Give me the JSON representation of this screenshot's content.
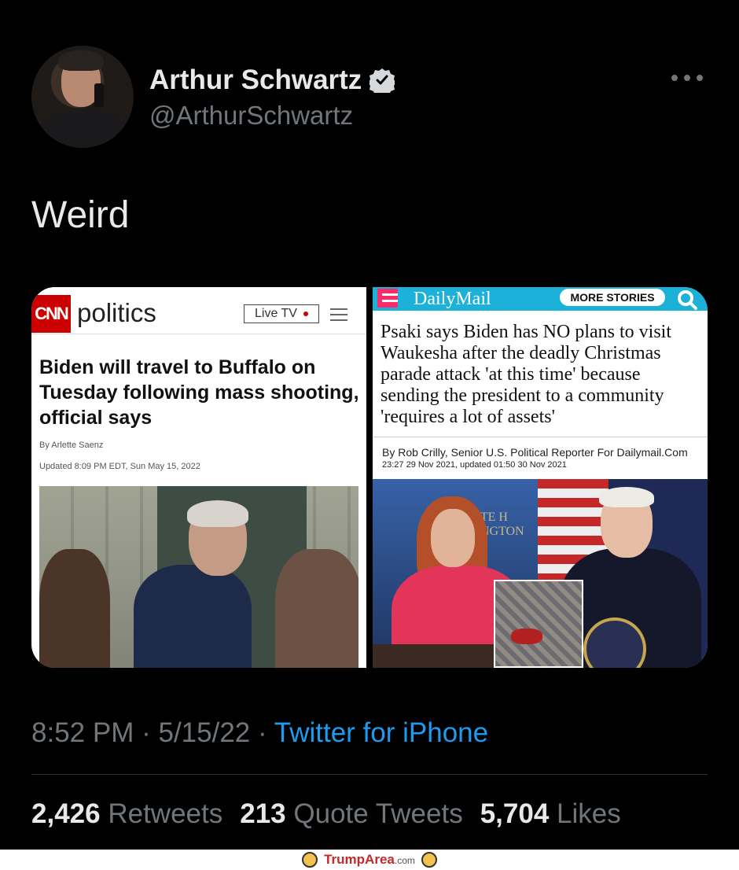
{
  "user": {
    "name": "Arthur Schwartz",
    "handle": "@ArthurSchwartz",
    "verified": true
  },
  "tweet": {
    "text": "Weird",
    "time": "8:52 PM",
    "date": "5/15/22",
    "source": "Twitter for iPhone",
    "separator": "·"
  },
  "media": {
    "left": {
      "brand_logo": "CNN",
      "section": "politics",
      "live_tv": "Live TV",
      "headline": "Biden will travel to Buffalo on Tuesday following mass shooting, official says",
      "byline": "By Arlette Saenz",
      "updated": "Updated 8:09 PM EDT, Sun May 15, 2022"
    },
    "right": {
      "brand_logo": "DailyMail",
      "more_stories": "MORE STORIES",
      "headline": "Psaki says Biden has NO plans to visit Waukesha after the deadly Christmas parade attack 'at this time' because sending the president to a community 'requires a lot of assets'",
      "byline": "By Rob Crilly, Senior U.S. Political Reporter For Dailymail.Com",
      "date": "23:27 29 Nov 2021, updated 01:50 30 Nov 2021",
      "photo_text": "HITE H\nHINGTON"
    }
  },
  "stats": {
    "retweets": {
      "count": "2,426",
      "label": "Retweets"
    },
    "quotes": {
      "count": "213",
      "label": "Quote Tweets"
    },
    "likes": {
      "count": "5,704",
      "label": "Likes"
    }
  },
  "watermark": {
    "name": "TrumpArea",
    "tld": ".com"
  },
  "colors": {
    "background": "#000000",
    "text_primary": "#e7e9ea",
    "text_secondary": "#71767b",
    "link": "#1d9bf0",
    "cnn_red": "#cc0000",
    "dailymail_blue": "#1bb1d8"
  },
  "icons": {
    "verified": "verified-badge-icon",
    "more": "more-options-icon",
    "menu": "hamburger-menu-icon",
    "search": "search-icon"
  }
}
